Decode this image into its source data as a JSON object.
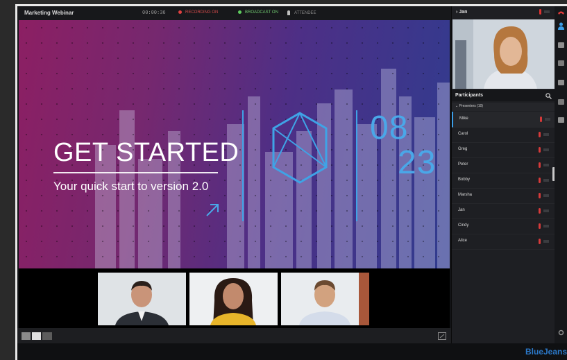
{
  "meeting": {
    "title": "Marketing Webinar",
    "timer": "00:00:36",
    "recording": "RECORDING ON",
    "broadcast": "BROADCAST ON",
    "attendee": "ATTENDEE"
  },
  "slide": {
    "headline": "GET STARTED",
    "subline": "Your quick start to version 2.0",
    "date_top": "08",
    "date_bottom": "23"
  },
  "panel": {
    "featured_name": "Jan",
    "participants_title": "Participants",
    "group_label": "Presenters (10)",
    "participants": [
      "Mike",
      "Carol",
      "Greg",
      "Peter",
      "Bobby",
      "Marsha",
      "Jan",
      "Cindy",
      "Alice"
    ]
  },
  "brand": "BlueJeans",
  "colors": {
    "accent": "#3b9ee8",
    "recording": "#e04040",
    "broadcast": "#5ecc5e",
    "slide_start": "#8c1f63",
    "slide_end": "#303c8f"
  },
  "icons": {
    "rail": [
      "phone-icon",
      "people-icon",
      "chat-icon",
      "share-icon",
      "stats-icon",
      "qa-icon",
      "settings-icon"
    ],
    "bottom": [
      "layout-icon",
      "fullscreen-icon"
    ]
  }
}
